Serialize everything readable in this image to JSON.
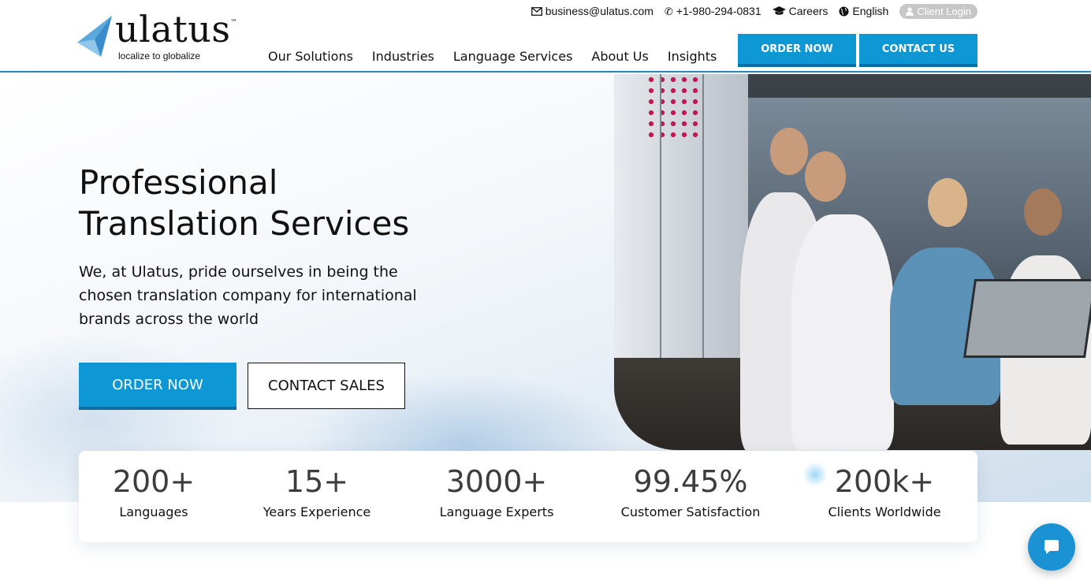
{
  "brand": {
    "name": "ulatus",
    "trademark": "™",
    "tagline": "localize to globalize"
  },
  "topbar": {
    "email": "business@ulatus.com",
    "phone": "+1-980-294-0831",
    "careers": "Careers",
    "language": "English",
    "client_login": "Client Login"
  },
  "nav": {
    "items": [
      "Our Solutions",
      "Industries",
      "Language Services",
      "About Us",
      "Insights"
    ]
  },
  "header_buttons": {
    "order": "ORDER NOW",
    "contact": "CONTACT US"
  },
  "hero": {
    "title_line1": "Professional",
    "title_line2": "Translation Services",
    "subtitle": "We, at Ulatus, pride ourselves in being the chosen translation company for international brands across the world",
    "order_button": "ORDER NOW",
    "sales_button": "CONTACT SALES"
  },
  "stats": [
    {
      "value": "200+",
      "label": "Languages"
    },
    {
      "value": "15+",
      "label": "Years Experience"
    },
    {
      "value": "3000+",
      "label": "Language Experts"
    },
    {
      "value": "99.45%",
      "label": "Customer Satisfaction"
    },
    {
      "value": "200k+",
      "label": "Clients Worldwide"
    }
  ],
  "colors": {
    "primary": "#0d97d4",
    "primary_dark": "#0a6fa0",
    "header_border": "#2a86b8"
  },
  "icons": {
    "email": "envelope-icon",
    "phone": "phone-icon",
    "careers": "graduation-cap-icon",
    "language": "globe-icon",
    "client_login": "user-icon",
    "chat": "chat-bubble-icon"
  }
}
